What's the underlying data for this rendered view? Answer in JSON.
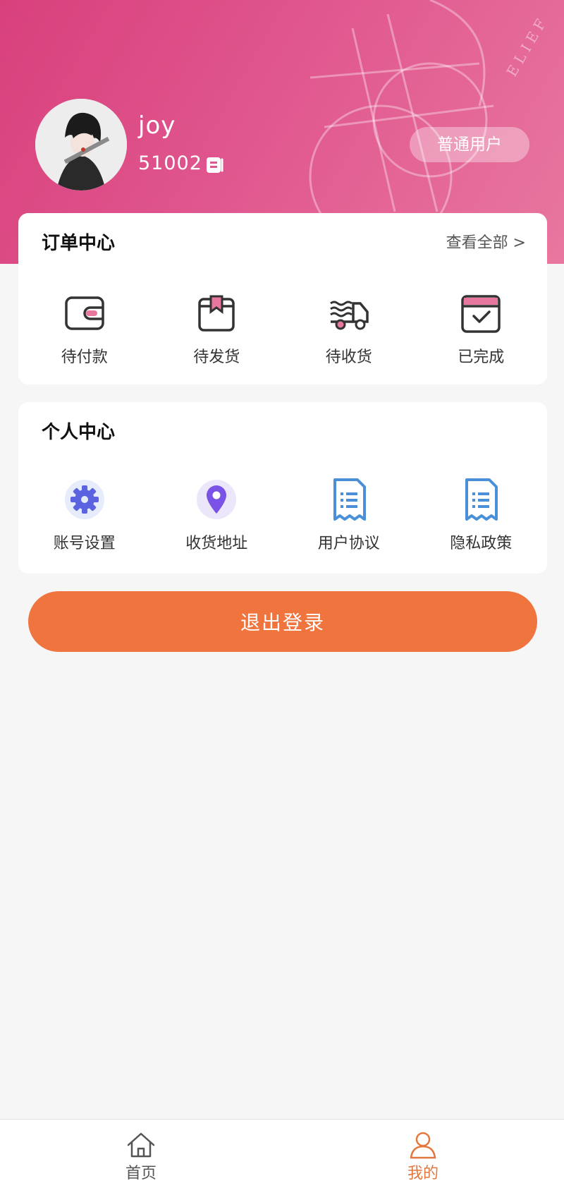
{
  "profile": {
    "name": "joy",
    "uid": "51002",
    "role_badge": "普通用户"
  },
  "orders": {
    "title": "订单中心",
    "view_all": "查看全部 >",
    "items": [
      {
        "label": "待付款",
        "icon": "wallet-icon"
      },
      {
        "label": "待发货",
        "icon": "package-icon"
      },
      {
        "label": "待收货",
        "icon": "truck-icon"
      },
      {
        "label": "已完成",
        "icon": "calendar-check-icon"
      }
    ]
  },
  "personal": {
    "title": "个人中心",
    "items": [
      {
        "label": "账号设置",
        "icon": "gear-icon"
      },
      {
        "label": "收货地址",
        "icon": "location-pin-icon"
      },
      {
        "label": "用户协议",
        "icon": "document-icon"
      },
      {
        "label": "隐私政策",
        "icon": "document-icon"
      }
    ]
  },
  "logout_label": "退出登录",
  "tabbar": {
    "items": [
      {
        "label": "首页",
        "icon": "home-icon",
        "active": false
      },
      {
        "label": "我的",
        "icon": "user-icon",
        "active": true
      }
    ]
  },
  "colors": {
    "header_start": "#d8407c",
    "header_end": "#e8779f",
    "accent_orange": "#ef743d",
    "active_tab": "#e2783f",
    "icon_blue": "#4a90d9",
    "icon_purple": "#6b5ce7"
  }
}
